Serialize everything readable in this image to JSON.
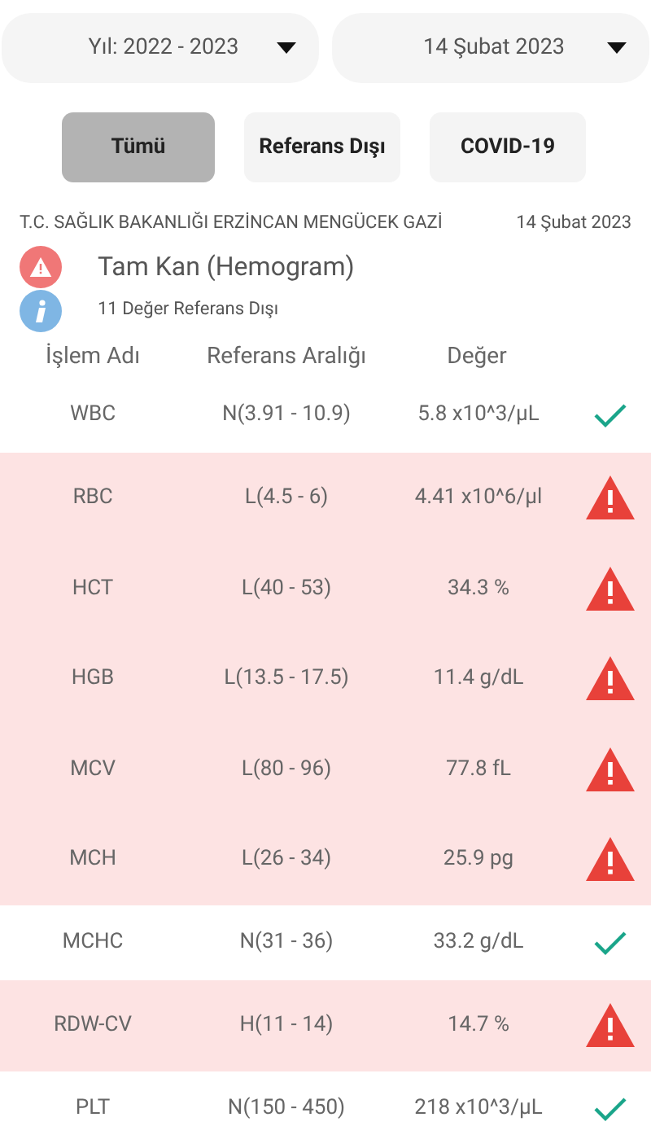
{
  "dropdowns": [
    {
      "label": "Yıl: 2022 - 2023"
    },
    {
      "label": "14 Şubat 2023"
    }
  ],
  "filters": [
    {
      "label": "Tümü",
      "selected": true
    },
    {
      "label": "Referans Dışı",
      "selected": false
    },
    {
      "label": "COVID-19",
      "selected": false
    }
  ],
  "report": {
    "hospital": "T.C. SAĞLIK BAKANLIĞI ERZİNCAN MENGÜCEK GAZİ",
    "date": "14 Şubat 2023",
    "title": "Tam Kan (Hemogram)",
    "summary": "11 Değer Referans Dışı"
  },
  "table": {
    "columns": [
      "İşlem Adı",
      "Referans Aralığı",
      "Değer"
    ],
    "rows": [
      {
        "name": "WBC",
        "range": "N(3.91 - 10.9)",
        "value": "5.8 x10^3/µL",
        "out_of_range": false
      },
      {
        "name": "RBC",
        "range": "L(4.5 - 6)",
        "value": "4.41 x10^6/µl",
        "out_of_range": true
      },
      {
        "name": "HCT",
        "range": "L(40 - 53)",
        "value": "34.3 %",
        "out_of_range": true
      },
      {
        "name": "HGB",
        "range": "L(13.5 - 17.5)",
        "value": "11.4 g/dL",
        "out_of_range": true
      },
      {
        "name": "MCV",
        "range": "L(80 - 96)",
        "value": "77.8 fL",
        "out_of_range": true
      },
      {
        "name": "MCH",
        "range": "L(26 - 34)",
        "value": "25.9 pg",
        "out_of_range": true
      },
      {
        "name": "MCHC",
        "range": "N(31 - 36)",
        "value": "33.2 g/dL",
        "out_of_range": false
      },
      {
        "name": "RDW-CV",
        "range": "H(11 - 14)",
        "value": "14.7 %",
        "out_of_range": true
      },
      {
        "name": "PLT",
        "range": "N(150 - 450)",
        "value": "218 x10^3/µL",
        "out_of_range": false
      }
    ]
  }
}
